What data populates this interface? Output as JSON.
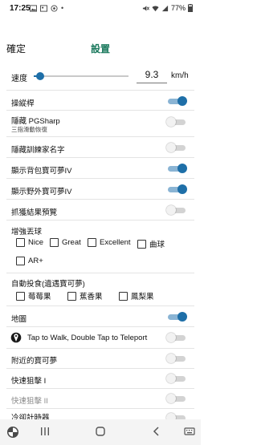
{
  "status": {
    "time": "17:25",
    "battery": "77%"
  },
  "header": {
    "confirm_label": "確定",
    "title": "設置"
  },
  "speed": {
    "label": "速度",
    "value": "9.3",
    "unit": "km/h",
    "slider_fraction": 0.07
  },
  "settings": [
    {
      "label": "操縱桿",
      "on": true
    },
    {
      "label": "隱藏 PGSharp",
      "sub": "三指滑動恢復",
      "on": false
    },
    {
      "label": "隱藏訓練家名字",
      "on": false
    },
    {
      "label": "顯示背包寶可夢IV",
      "on": true
    },
    {
      "label": "顯示野外寶可夢IV",
      "on": true
    },
    {
      "label": "抓獲結果預覽",
      "on": false
    }
  ],
  "throws": {
    "label": "增強丟球",
    "options": [
      "Nice",
      "Great",
      "Excellent",
      "曲球",
      "AR+"
    ]
  },
  "berries": {
    "label": "自動投食(遺遇寶可夢)",
    "options": [
      "莓莓果",
      "蕉香果",
      "鳳梨果"
    ]
  },
  "settings2": [
    {
      "label": "地圖",
      "on": true
    },
    {
      "label": "Tap to Walk, Double Tap to Teleport",
      "on": false
    },
    {
      "label": "附近的寶可夢",
      "on": false
    },
    {
      "label": "快速狙擊 I",
      "on": false
    },
    {
      "label": "快速狙擊 II",
      "on": false,
      "muted": true
    },
    {
      "label": "冷卻計時器",
      "on": false
    }
  ],
  "colors": {
    "accent": "#1e6fa8",
    "title": "#1c7a5e"
  }
}
